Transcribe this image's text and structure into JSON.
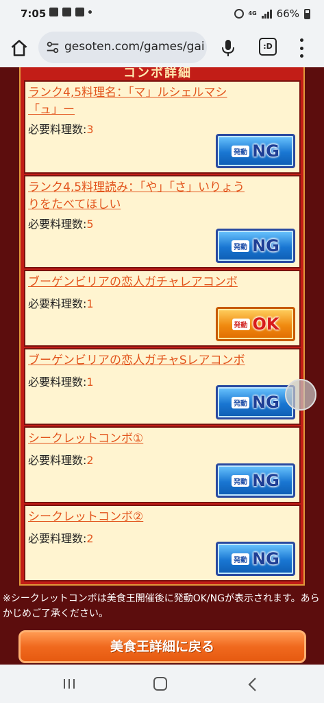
{
  "status": {
    "time": "7:05",
    "network": "4G",
    "battery": "66%"
  },
  "browser": {
    "url": "gesoten.com/games/gai",
    "tabs_label": ":D"
  },
  "page": {
    "section_header": "コンボ詳細",
    "items": [
      {
        "title_line1": "ランク4,5料理名：「マ」ルシェルマシ",
        "title_line2": "「ュ」ー",
        "req_label": "必要料理数:",
        "req_value": "3",
        "status": "NG"
      },
      {
        "title_line1": "ランク4,5料理読み：「や」「さ」いりょう",
        "title_line2": "りをたべてほしい",
        "req_label": "必要料理数:",
        "req_value": "5",
        "status": "NG"
      },
      {
        "title_line1": "ブーゲンビリアの恋人ガチャレアコンボ",
        "title_line2": "",
        "req_label": "必要料理数:",
        "req_value": "1",
        "status": "OK"
      },
      {
        "title_line1": "ブーゲンビリアの恋人ガチャSレアコンボ",
        "title_line2": "",
        "req_label": "必要料理数:",
        "req_value": "1",
        "status": "NG"
      },
      {
        "title_line1": "シークレットコンボ①",
        "title_line2": "",
        "req_label": "必要料理数:",
        "req_value": "2",
        "status": "NG"
      },
      {
        "title_line1": "シークレットコンボ②",
        "title_line2": "",
        "req_label": "必要料理数:",
        "req_value": "2",
        "status": "NG"
      }
    ],
    "button_small": "発動",
    "note": "※シークレットコンボは美食王開催後に発動OK/NGが表示されます。あらかじめご了承ください。",
    "back_button": "美食王詳細に戻る"
  },
  "colors": {
    "page_bg": "#5c0d0d",
    "panel": "#c21d17",
    "item_bg": "#fff4d0",
    "title_text": "#e2541c",
    "ng_blue": "#1976d2",
    "ok_orange": "#f08a10",
    "back_button": "#f0691e"
  }
}
